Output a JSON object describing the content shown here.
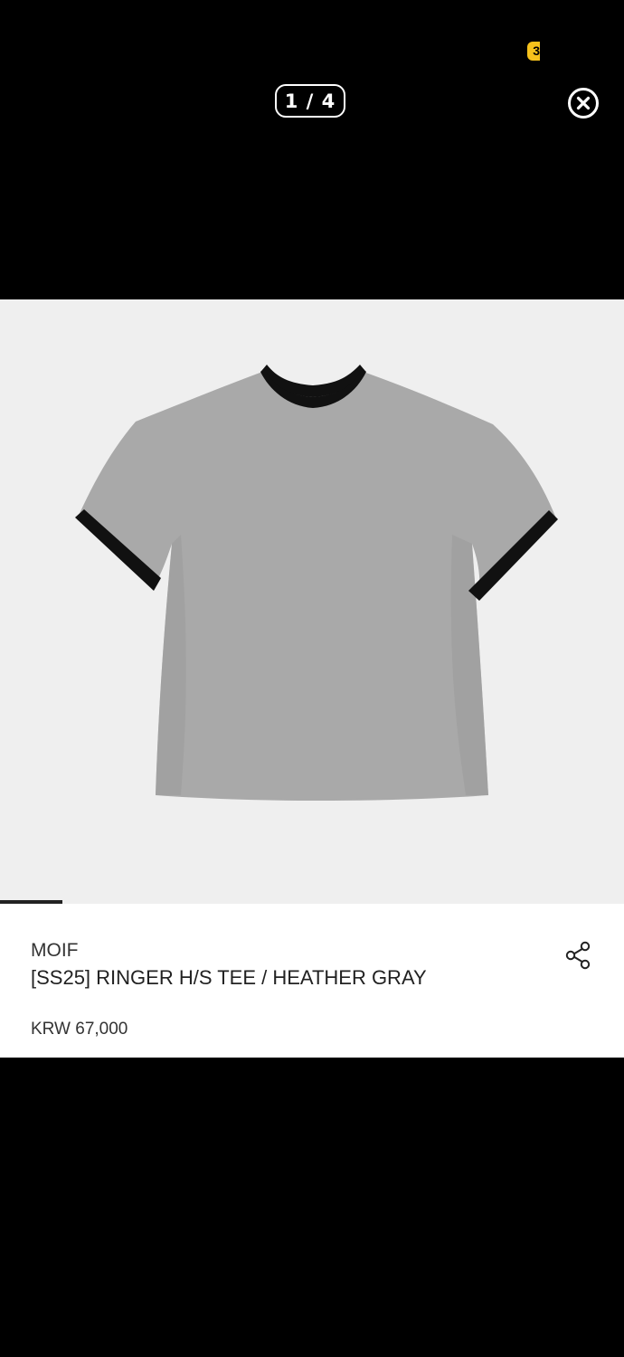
{
  "viewer": {
    "counter": "1 / 4",
    "current_index": 1,
    "total_images": 4,
    "progress_fraction": 0.25,
    "status_badge": "3"
  },
  "product": {
    "brand": "MOIF",
    "name": "[SS25] RINGER H/S TEE / HEATHER GRAY",
    "price": "KRW 67,000"
  },
  "icons": {
    "close": "close-circle-icon",
    "share": "share-icon"
  },
  "colors": {
    "background": "#000000",
    "image_bg": "#efefef",
    "shirt_body": "#a8a8a8",
    "shirt_trim": "#111111",
    "badge": "#f6c21c"
  }
}
